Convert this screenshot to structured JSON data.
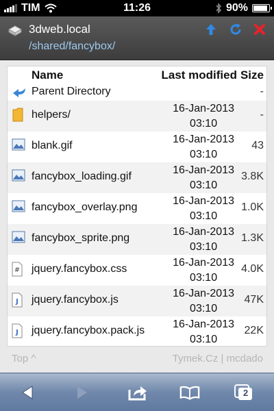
{
  "status_bar": {
    "carrier": "TIM",
    "time": "11:26",
    "battery": "90%",
    "battery_level": 0.9,
    "icons": [
      "signal-icon",
      "wifi-icon",
      "bluetooth-icon",
      "battery-icon"
    ]
  },
  "header": {
    "host": "3dweb.local",
    "path": "/shared/fancybox/",
    "buttons": [
      "up-arrow-icon",
      "refresh-icon",
      "close-icon"
    ],
    "colors": {
      "up": "#2f8ae6",
      "refresh": "#2f8ae6",
      "close": "#e8222b"
    }
  },
  "listing": {
    "columns": {
      "name": "Name",
      "modified": "Last modified",
      "size": "Size"
    },
    "parent": {
      "name": "Parent Directory",
      "size": "-",
      "icon": "back-arrow-icon"
    },
    "rows": [
      {
        "name": "helpers/",
        "date": "16-Jan-2013",
        "time": "03:10",
        "size": "-",
        "icon": "folder-icon"
      },
      {
        "name": "blank.gif",
        "date": "16-Jan-2013",
        "time": "03:10",
        "size": "43",
        "icon": "image-file-icon"
      },
      {
        "name": "fancybox_loading.gif",
        "date": "16-Jan-2013",
        "time": "03:10",
        "size": "3.8K",
        "icon": "image-file-icon"
      },
      {
        "name": "fancybox_overlay.png",
        "date": "16-Jan-2013",
        "time": "03:10",
        "size": "1.0K",
        "icon": "image-file-icon"
      },
      {
        "name": "fancybox_sprite.png",
        "date": "16-Jan-2013",
        "time": "03:10",
        "size": "1.3K",
        "icon": "image-file-icon"
      },
      {
        "name": "jquery.fancybox.css",
        "date": "16-Jan-2013",
        "time": "03:10",
        "size": "4.0K",
        "icon": "css-file-icon"
      },
      {
        "name": "jquery.fancybox.js",
        "date": "16-Jan-2013",
        "time": "03:10",
        "size": "47K",
        "icon": "js-file-icon"
      },
      {
        "name": "jquery.fancybox.pack.js",
        "date": "16-Jan-2013",
        "time": "03:10",
        "size": "22K",
        "icon": "js-file-icon"
      }
    ]
  },
  "footer": {
    "top_link": "Top ^",
    "credits": "Tymek.Cz | mcdado"
  },
  "toolbar": {
    "buttons": [
      "back-icon",
      "forward-icon",
      "share-icon",
      "bookmarks-icon",
      "tabs-icon"
    ],
    "tab_count": "2"
  }
}
